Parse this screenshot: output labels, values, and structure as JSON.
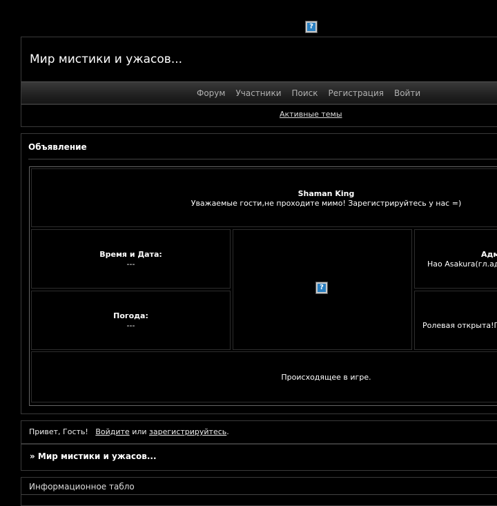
{
  "header": {
    "title": "Мир мистики и ужасов...",
    "nav": [
      "Форум",
      "Участники",
      "Поиск",
      "Регистрация",
      "Войти"
    ],
    "active_topics": "Активные темы"
  },
  "announcement": {
    "title": "Объявление",
    "game_title": "Shaman King",
    "game_sub": "Уважаемые гости,не проходите мимо! Зарегистрируйтесь у нас =)",
    "time_label": "Время и Дата:",
    "time_value": "---",
    "weather_label": "Погода:",
    "weather_value": "---",
    "admin_label": "Адм",
    "admin_value": "Hao Asakura(гл.ад",
    "rp_status": "Ролевая открыта!П",
    "happening": "Происходящее в игре."
  },
  "greeting": {
    "hello": "Привет, Гость!",
    "login": "Войдите",
    "or": "или",
    "register": "зарегистрируйтесь",
    "dot": "."
  },
  "breadcrumb": "» Мир мистики и ужасов...",
  "info_board": "Информационное табло",
  "icons": {
    "broken_image": "question-icon"
  }
}
